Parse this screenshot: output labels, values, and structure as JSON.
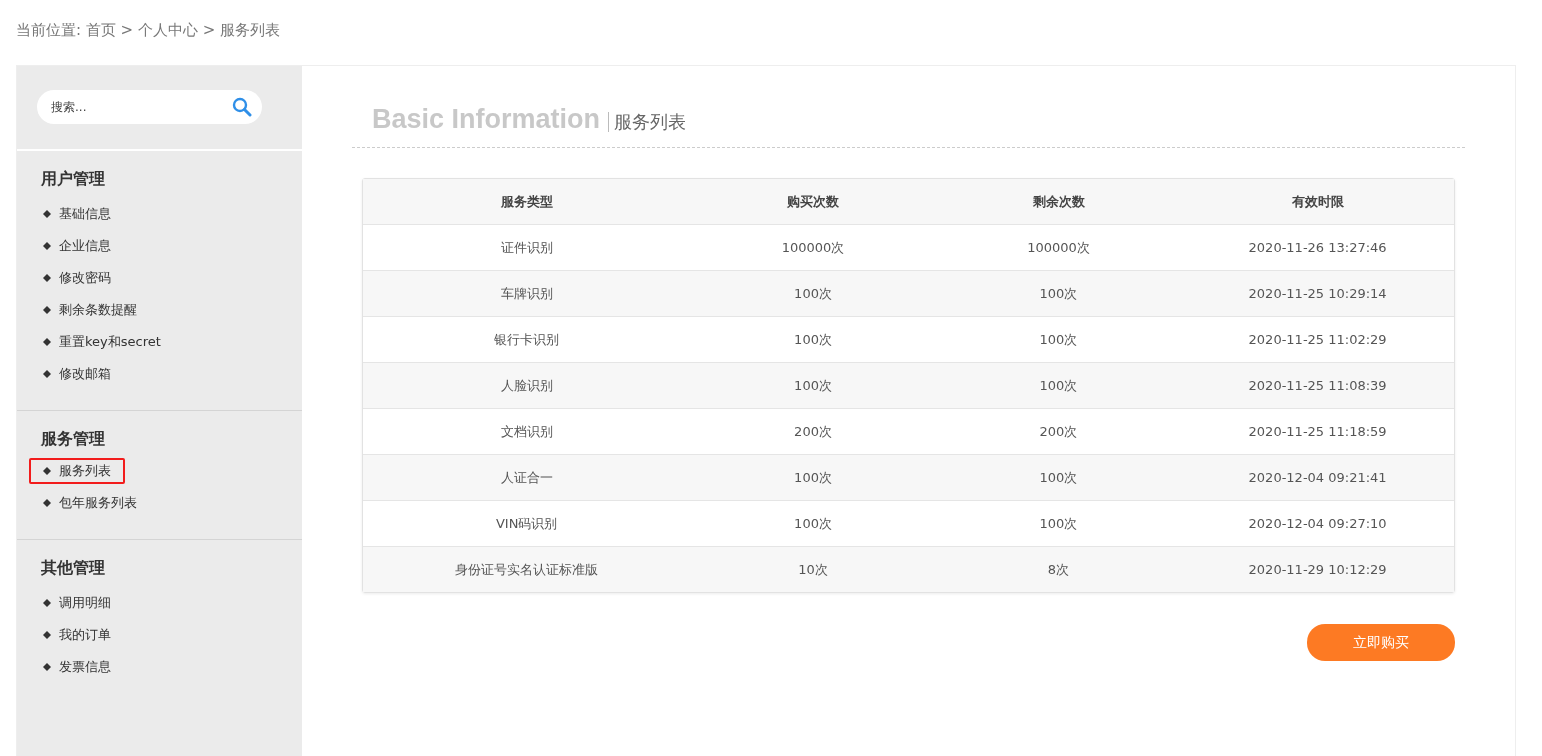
{
  "breadcrumb": {
    "label": "当前位置:",
    "items": [
      "首页",
      "个人中心",
      "服务列表"
    ],
    "separator": ">"
  },
  "sidebar": {
    "search": {
      "placeholder": "搜索..."
    },
    "groups": [
      {
        "title": "用户管理",
        "items": [
          {
            "label": "基础信息",
            "selected": false
          },
          {
            "label": "企业信息",
            "selected": false
          },
          {
            "label": "修改密码",
            "selected": false
          },
          {
            "label": "剩余条数提醒",
            "selected": false
          },
          {
            "label": "重置key和secret",
            "selected": false
          },
          {
            "label": "修改邮箱",
            "selected": false
          }
        ]
      },
      {
        "title": "服务管理",
        "items": [
          {
            "label": "服务列表",
            "selected": true
          },
          {
            "label": "包年服务列表",
            "selected": false
          }
        ]
      },
      {
        "title": "其他管理",
        "items": [
          {
            "label": "调用明细",
            "selected": false
          },
          {
            "label": "我的订单",
            "selected": false
          },
          {
            "label": "发票信息",
            "selected": false
          }
        ]
      }
    ]
  },
  "heading": {
    "title": "Basic Information",
    "subtitle": "服务列表"
  },
  "table": {
    "columns": [
      "服务类型",
      "购买次数",
      "剩余次数",
      "有效时限"
    ],
    "rows": [
      [
        "证件识别",
        "100000次",
        "100000次",
        "2020-11-26 13:27:46"
      ],
      [
        "车牌识别",
        "100次",
        "100次",
        "2020-11-25 10:29:14"
      ],
      [
        "银行卡识别",
        "100次",
        "100次",
        "2020-11-25 11:02:29"
      ],
      [
        "人脸识别",
        "100次",
        "100次",
        "2020-11-25 11:08:39"
      ],
      [
        "文档识别",
        "200次",
        "200次",
        "2020-11-25 11:18:59"
      ],
      [
        "人证合一",
        "100次",
        "100次",
        "2020-12-04 09:21:41"
      ],
      [
        "VIN码识别",
        "100次",
        "100次",
        "2020-12-04 09:27:10"
      ],
      [
        "身份证号实名认证标准版",
        "10次",
        "8次",
        "2020-11-29 10:12:29"
      ]
    ]
  },
  "buy_button": "立即购买"
}
